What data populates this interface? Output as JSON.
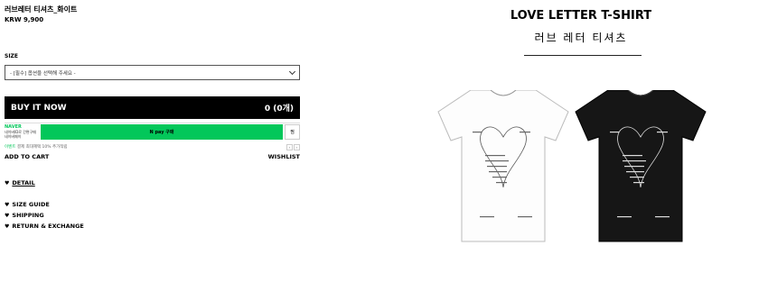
{
  "product": {
    "name": "러브레터 티셔츠_화이트",
    "price": "KRW 9,900"
  },
  "size": {
    "label": "SIZE",
    "placeholder": "- [필수] 옵션을 선택해 주세요 -"
  },
  "buy": {
    "label": "BUY IT NOW",
    "count": "0 (0개)"
  },
  "npay": {
    "brand": "NAVER",
    "line1": "네이버ID로 간편구매",
    "line2": "네이버페이",
    "button": "N pay 구매",
    "side": "찜",
    "note_brand": "이벤트",
    "note": "결제 최대혜택 10% 추가적립"
  },
  "actions": {
    "cart": "ADD TO CART",
    "wishlist": "WISHLIST"
  },
  "links": {
    "detail": "DETAIL",
    "size_guide": "SIZE GUIDE",
    "shipping": "SHIPPING",
    "return": "RETURN & EXCHANGE"
  },
  "hero": {
    "title": "LOVE LETTER T-SHIRT",
    "subtitle": "러브 레터 티셔츠"
  },
  "colors": {
    "npay_green": "#03c75a",
    "black": "#000000"
  }
}
